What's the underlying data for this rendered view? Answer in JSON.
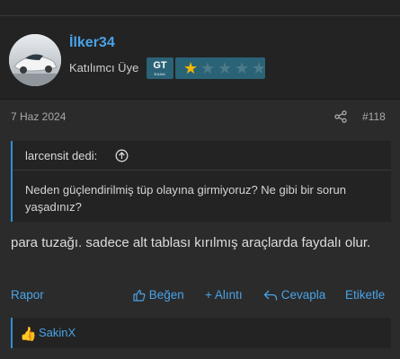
{
  "post": {
    "username": "İlker34",
    "user_title": "Katılımcı Üye",
    "badge_big": "GT",
    "badge_small": "RANK",
    "rank_stars_filled": 1,
    "rank_stars_total": 5,
    "date": "7 Haz 2024",
    "post_number": "#118",
    "message": "para tuzağı. sadece alt tablası kırılmış araçlarda faydalı olur."
  },
  "quote": {
    "author_line": "larcensit dedi:",
    "body": "Neden güçlendirilmiş tüp olayına girmiyoruz? Ne gibi bir sorun yaşadınız?"
  },
  "actions": {
    "report": "Rapor",
    "like": "Beğen",
    "quote": "+ Alıntı",
    "reply": "Cevapla",
    "tag": "Etiketle"
  },
  "reactions": {
    "icon": "thumbs-up-icon",
    "users": "SakinX"
  },
  "colors": {
    "accent": "#4aa3e8",
    "star_on": "#f2b705",
    "badge_bg": "#2a6276"
  }
}
